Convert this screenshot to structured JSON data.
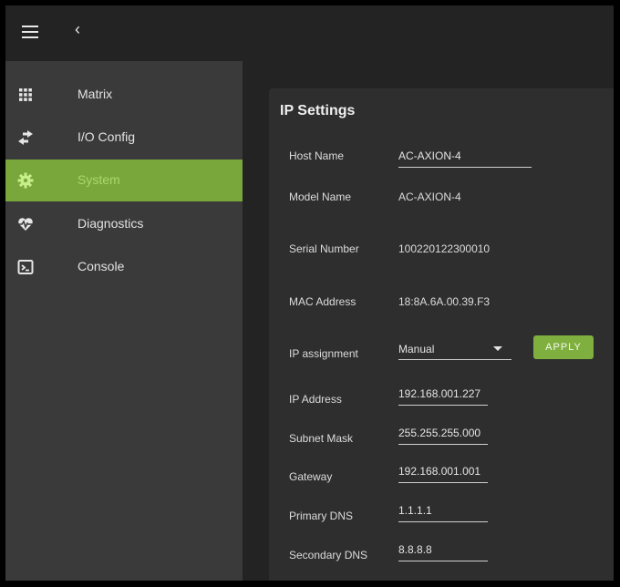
{
  "topbar": {
    "menu_icon": "hamburger-icon",
    "back_icon": "chevron-left-icon",
    "back_glyph": "‹"
  },
  "sidebar": {
    "items": [
      {
        "label": "Matrix",
        "icon": "grid-icon",
        "active": false
      },
      {
        "label": "I/O Config",
        "icon": "swap-arrows-icon",
        "active": false
      },
      {
        "label": "System",
        "icon": "gear-icon",
        "active": true
      },
      {
        "label": "Diagnostics",
        "icon": "heartbeat-icon",
        "active": false
      },
      {
        "label": "Console",
        "icon": "terminal-icon",
        "active": false
      }
    ]
  },
  "ip_settings": {
    "title": "IP Settings",
    "host_name": {
      "label": "Host Name",
      "value": "AC-AXION-4"
    },
    "model_name": {
      "label": "Model Name",
      "value": "AC-AXION-4"
    },
    "serial_number": {
      "label": "Serial Number",
      "value": "100220122300010"
    },
    "mac_address": {
      "label": "MAC Address",
      "value": "18:8A.6A.00.39.F3"
    },
    "ip_assignment": {
      "label": "IP assignment",
      "value": "Manual",
      "apply_label": "APPLY"
    },
    "ip_address": {
      "label": "IP Address",
      "value": "192.168.001.227"
    },
    "subnet_mask": {
      "label": "Subnet Mask",
      "value": "255.255.255.000"
    },
    "gateway": {
      "label": "Gateway",
      "value": "192.168.001.001"
    },
    "primary_dns": {
      "label": "Primary DNS",
      "value": "1.1.1.1"
    },
    "secondary_dns": {
      "label": "Secondary DNS",
      "value": "8.8.8.8"
    }
  },
  "colors": {
    "accent": "#7fb03f",
    "active_item": "#79a73c",
    "active_text": "#a8d86b"
  }
}
